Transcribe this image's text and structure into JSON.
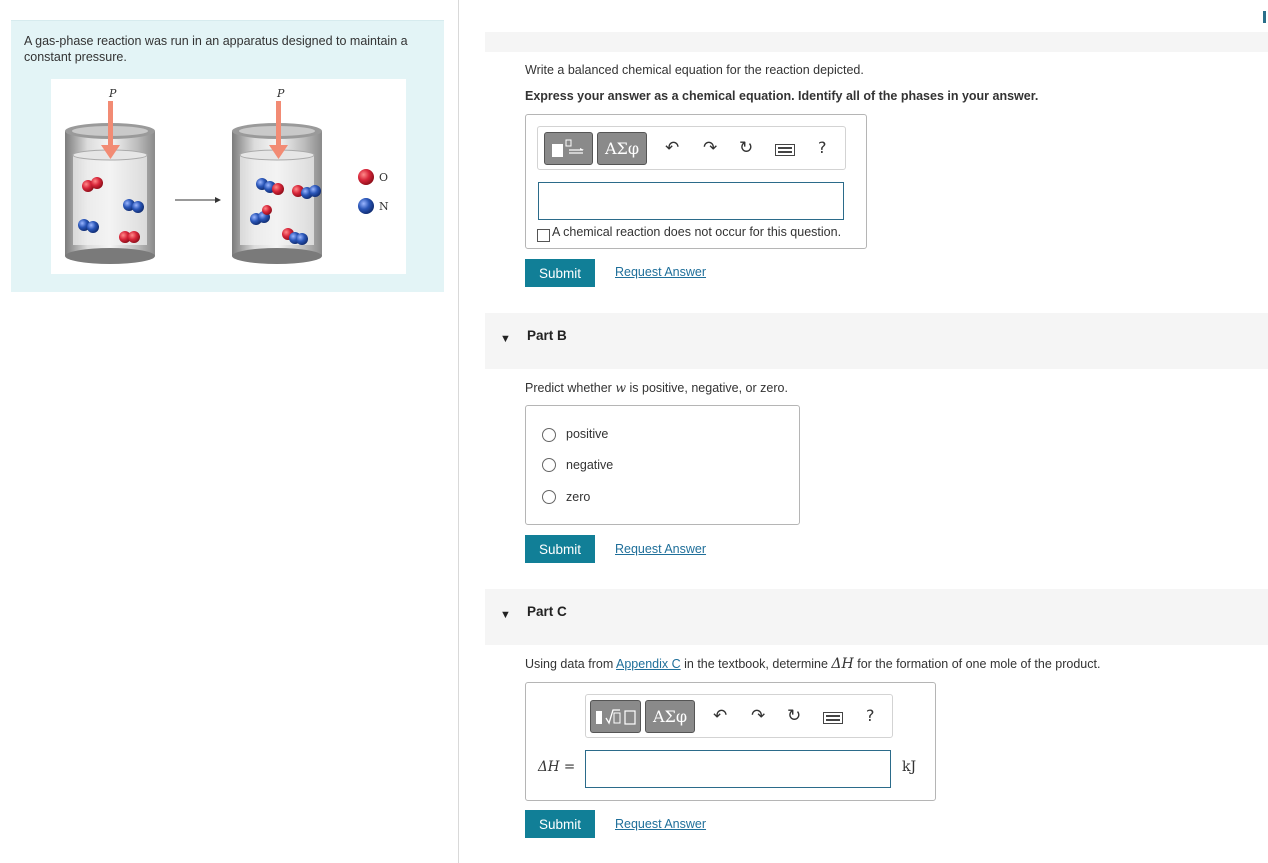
{
  "intro": {
    "text": "A gas-phase reaction was run in an apparatus designed to maintain a constant pressure.",
    "label_p": "P",
    "legend_o": "O",
    "legend_n": "N",
    "colors": {
      "oxygen": "#d8263a",
      "nitrogen": "#2a56b8",
      "arrow": "#f28b74"
    }
  },
  "part_a": {
    "instruction": "Write a balanced chemical equation for the reaction depicted.",
    "format_hint": "Express your answer as a chemical equation. Identify all of the phases in your answer.",
    "toolbar": {
      "greek_label": "ΑΣφ",
      "help_label": "?"
    },
    "checkbox_label": "A chemical reaction does not occur for this question.",
    "submit_label": "Submit",
    "request_label": "Request Answer"
  },
  "part_b": {
    "title": "Part B",
    "question_pre": "Predict whether ",
    "question_var": "w",
    "question_post": " is positive, negative, or zero.",
    "options": [
      "positive",
      "negative",
      "zero"
    ],
    "submit_label": "Submit",
    "request_label": "Request Answer"
  },
  "part_c": {
    "title": "Part C",
    "question_pre": "Using data from ",
    "link_text": "Appendix C",
    "question_mid": " in the textbook, determine ",
    "question_var": "ΔH",
    "question_post": " for the formation of one mole of the product.",
    "toolbar": {
      "greek_label": "ΑΣφ",
      "help_label": "?"
    },
    "field_label": "ΔH =",
    "unit": "kJ",
    "submit_label": "Submit",
    "request_label": "Request Answer"
  }
}
